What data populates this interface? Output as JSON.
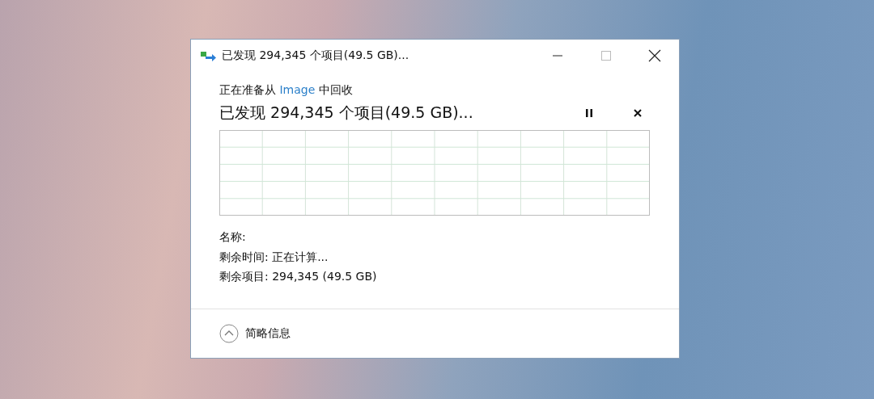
{
  "window": {
    "title": "已发现 294,345 个项目(49.5 GB)..."
  },
  "operation": {
    "prefix": "正在准备从",
    "link": "Image",
    "suffix": "中回收"
  },
  "status": "已发现 294,345 个项目(49.5 GB)...",
  "details": [
    {
      "label": "名称:"
    },
    {
      "label": "剩余时间:",
      "value": "正在计算..."
    },
    {
      "label": "剩余项目:",
      "value": "294,345 (49.5 GB)"
    }
  ],
  "footer": {
    "toggle": "简略信息",
    "expanded": true
  }
}
